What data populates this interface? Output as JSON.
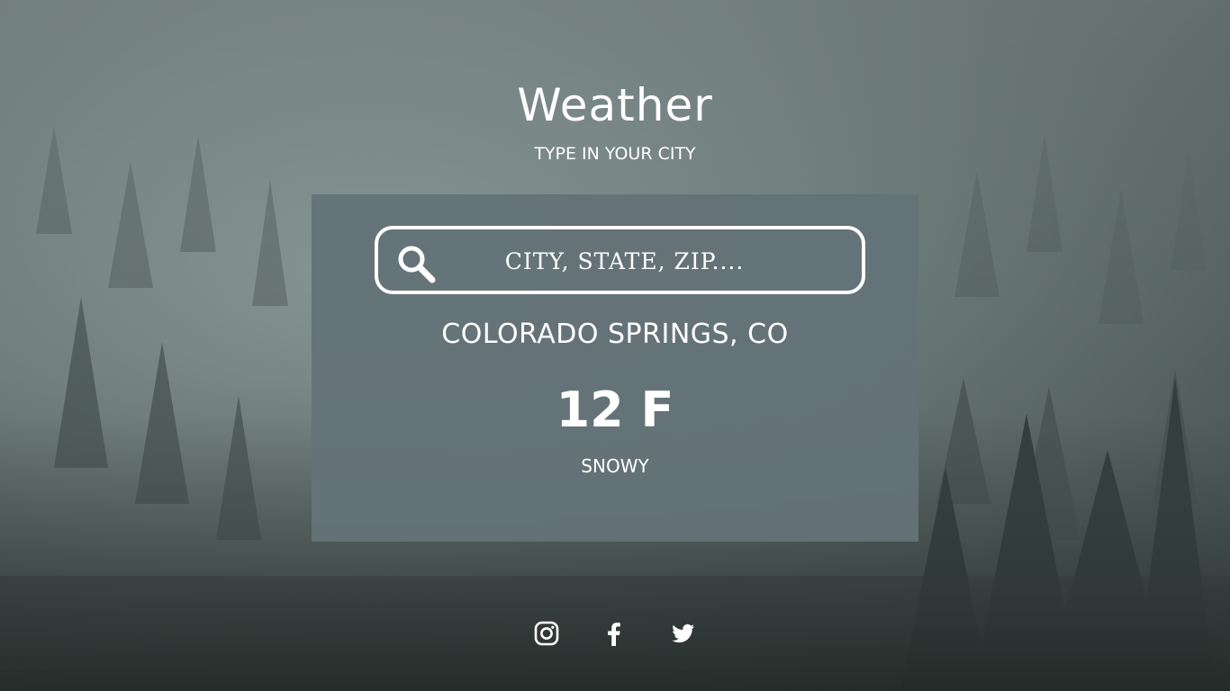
{
  "header": {
    "title": "Weather",
    "subtitle": "TYPE IN YOUR CITY"
  },
  "search": {
    "placeholder": "CITY, STATE, ZIP....",
    "icon": "search-icon"
  },
  "result": {
    "location": "COLORADO SPRINGS, CO",
    "temperature": "12 F",
    "condition": "SNOWY"
  },
  "social": [
    {
      "name": "instagram",
      "icon": "instagram-icon"
    },
    {
      "name": "facebook",
      "icon": "facebook-icon"
    },
    {
      "name": "twitter",
      "icon": "twitter-icon"
    }
  ],
  "colors": {
    "card": "#64727a",
    "text": "#ffffff"
  }
}
